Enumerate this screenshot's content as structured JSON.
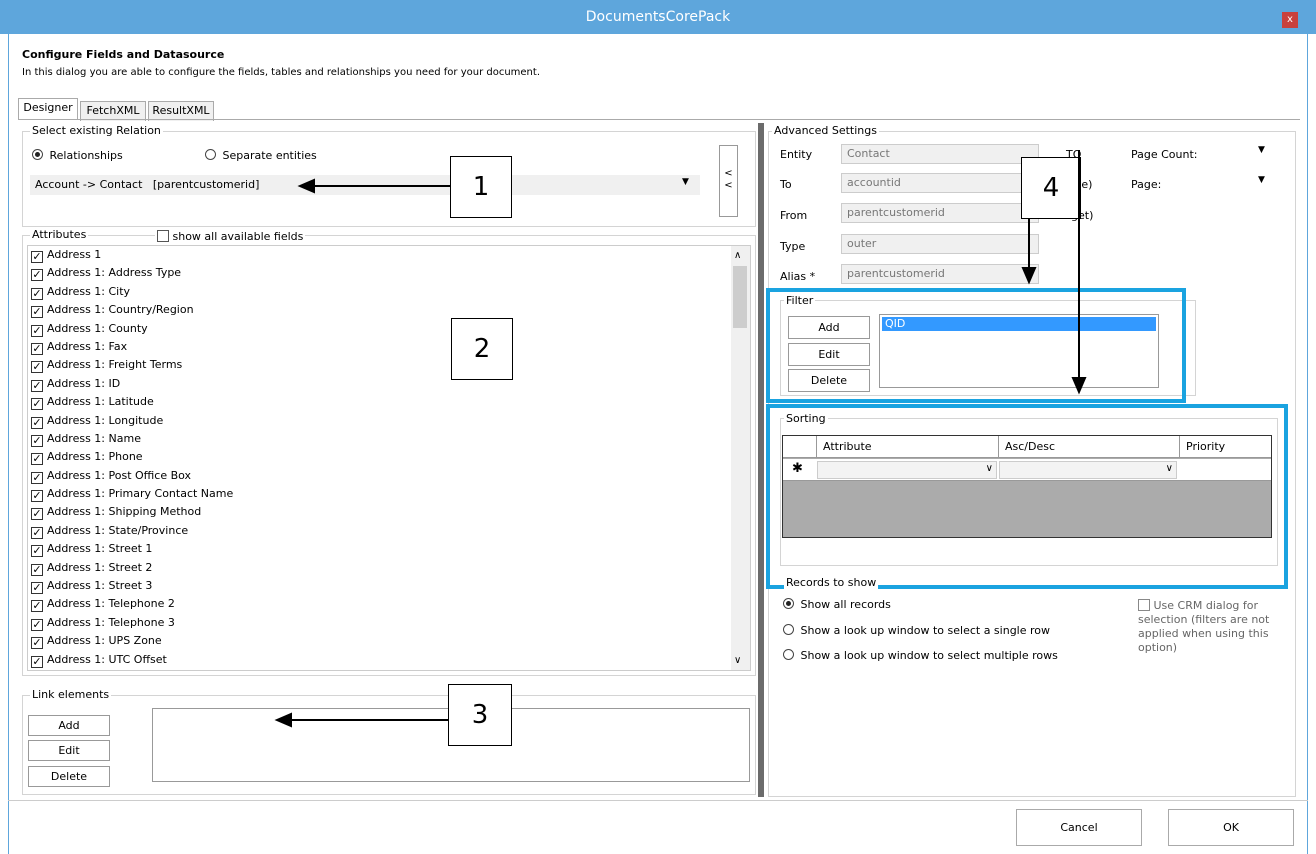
{
  "window": {
    "title": "DocumentsCorePack",
    "close_glyph": "x"
  },
  "header": {
    "title": "Configure Fields and Datasource",
    "description": "In this dialog you are able to configure the fields, tables and relationships you need for your document."
  },
  "tabs": [
    {
      "label": "Designer"
    },
    {
      "label": "FetchXML"
    },
    {
      "label": "ResultXML"
    }
  ],
  "relation": {
    "group_label": "Select existing Relation",
    "radio_relationships": "Relationships",
    "radio_separate": "Separate entities",
    "selected": "Account -> Contact   [parentcustomerid]",
    "collapse_glyph": "<\n<"
  },
  "attributes": {
    "group_label": "Attributes",
    "show_all_label": "show all available fields",
    "items": [
      "Address 1",
      "Address 1: Address Type",
      "Address 1: City",
      "Address 1: Country/Region",
      "Address 1: County",
      "Address 1: Fax",
      "Address 1: Freight Terms",
      "Address 1: ID",
      "Address 1: Latitude",
      "Address 1: Longitude",
      "Address 1: Name",
      "Address 1: Phone",
      "Address 1: Post Office Box",
      "Address 1: Primary Contact Name",
      "Address 1: Shipping Method",
      "Address 1: State/Province",
      "Address 1: Street 1",
      "Address 1: Street 2",
      "Address 1: Street 3",
      "Address 1: Telephone 2",
      "Address 1: Telephone 3",
      "Address 1: UPS Zone",
      "Address 1: UTC Offset"
    ]
  },
  "link_elements": {
    "group_label": "Link elements",
    "add": "Add",
    "edit": "Edit",
    "delete": "Delete"
  },
  "advanced": {
    "group_label": "Advanced Settings",
    "entity_label": "Entity",
    "entity_value": "Contact",
    "to_label": "To",
    "to_value": "accountid",
    "from_label": "From",
    "from_value": "parentcustomerid",
    "type_label": "Type",
    "type_value": "outer",
    "alias_label": "Alias *",
    "alias_value": "parentcustomerid",
    "top_label": "TO",
    "source_label": "rce)",
    "target_label": "get)",
    "page_count_label": "Page Count:",
    "page_label": "Page:"
  },
  "filter": {
    "group_label": "Filter",
    "add": "Add",
    "edit": "Edit",
    "delete": "Delete",
    "items": [
      "QID"
    ]
  },
  "sorting": {
    "group_label": "Sorting",
    "columns": [
      "Attribute",
      "Asc/Desc",
      "Priority"
    ],
    "new_row_glyph": "✱"
  },
  "records": {
    "group_label": "Records to show",
    "opt_all": "Show all records",
    "opt_single": "Show a look up window to select a single row",
    "opt_multi": "Show a look up window to select multiple rows",
    "crm_label": "Use CRM dialog for selection (filters are not applied when using this option)"
  },
  "footer": {
    "cancel": "Cancel",
    "ok": "OK"
  },
  "annotations": [
    "1",
    "2",
    "3",
    "4"
  ],
  "colors": {
    "titlebar": "#5ea6dc",
    "highlight": "#1aa3e0",
    "selection": "#3399ff",
    "close": "#c9413d"
  }
}
